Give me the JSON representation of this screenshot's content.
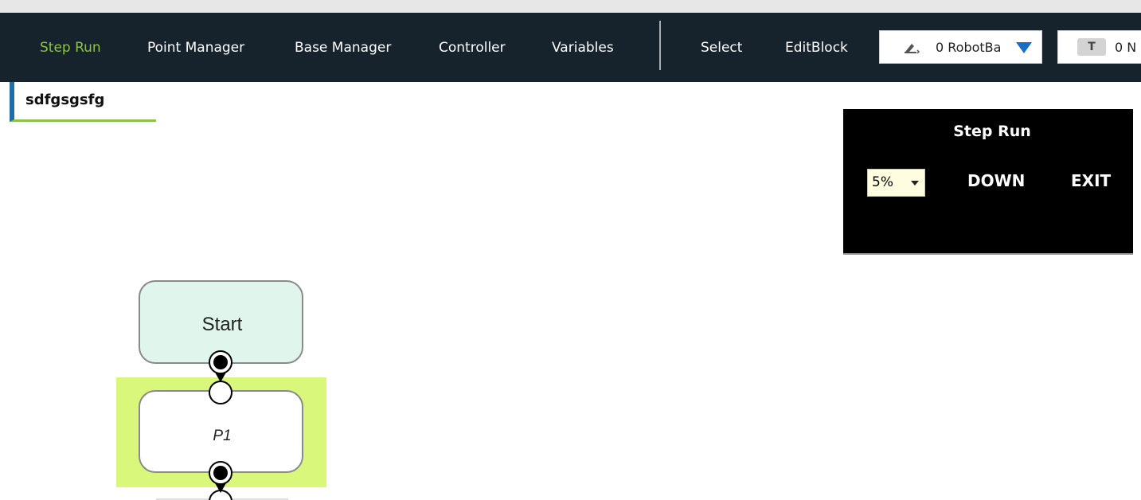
{
  "nav": {
    "items": [
      "Step Run",
      "Point Manager",
      "Base Manager",
      "Controller",
      "Variables"
    ],
    "active": "Step Run",
    "select_label": "Select",
    "editblock_label": "EditBlock"
  },
  "base_dropdown": {
    "value": "0 RobotBa",
    "icon": "robot-base-icon"
  },
  "tool_dropdown": {
    "badge": "T",
    "value": "0 N"
  },
  "tab": {
    "label": "sdfgsgsfg"
  },
  "step_panel": {
    "title": "Step Run",
    "speed": "5%",
    "down_label": "DOWN",
    "exit_label": "EXIT"
  },
  "flow": {
    "start_label": "Start",
    "point_label": "P1"
  },
  "colors": {
    "navbar": "#16232d",
    "active_nav": "#8bc34a",
    "tab_accent": "#1e6fa8",
    "start_fill": "#e0f5ec",
    "highlight": "#d9f77a",
    "dropdown_arrow": "#1a6fc4"
  }
}
